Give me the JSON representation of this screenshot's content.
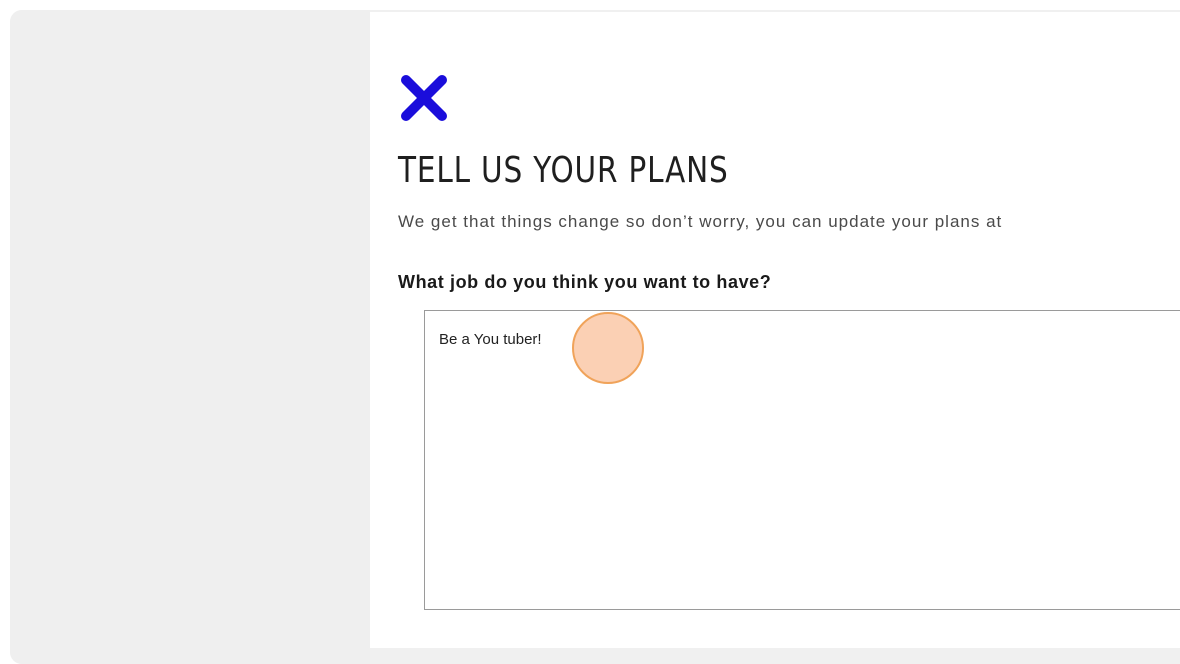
{
  "modal": {
    "close_icon": "close-icon",
    "accent_color": "#1a0ddb",
    "title": "TELL US YOUR PLANS",
    "subtitle": "We get that things change so don’t worry, you can update your plans at",
    "question": "What job do you think you want to have?",
    "answer_value": "Be a You tuber!"
  },
  "cursor": {
    "indicator_color": "#f0a35a"
  }
}
